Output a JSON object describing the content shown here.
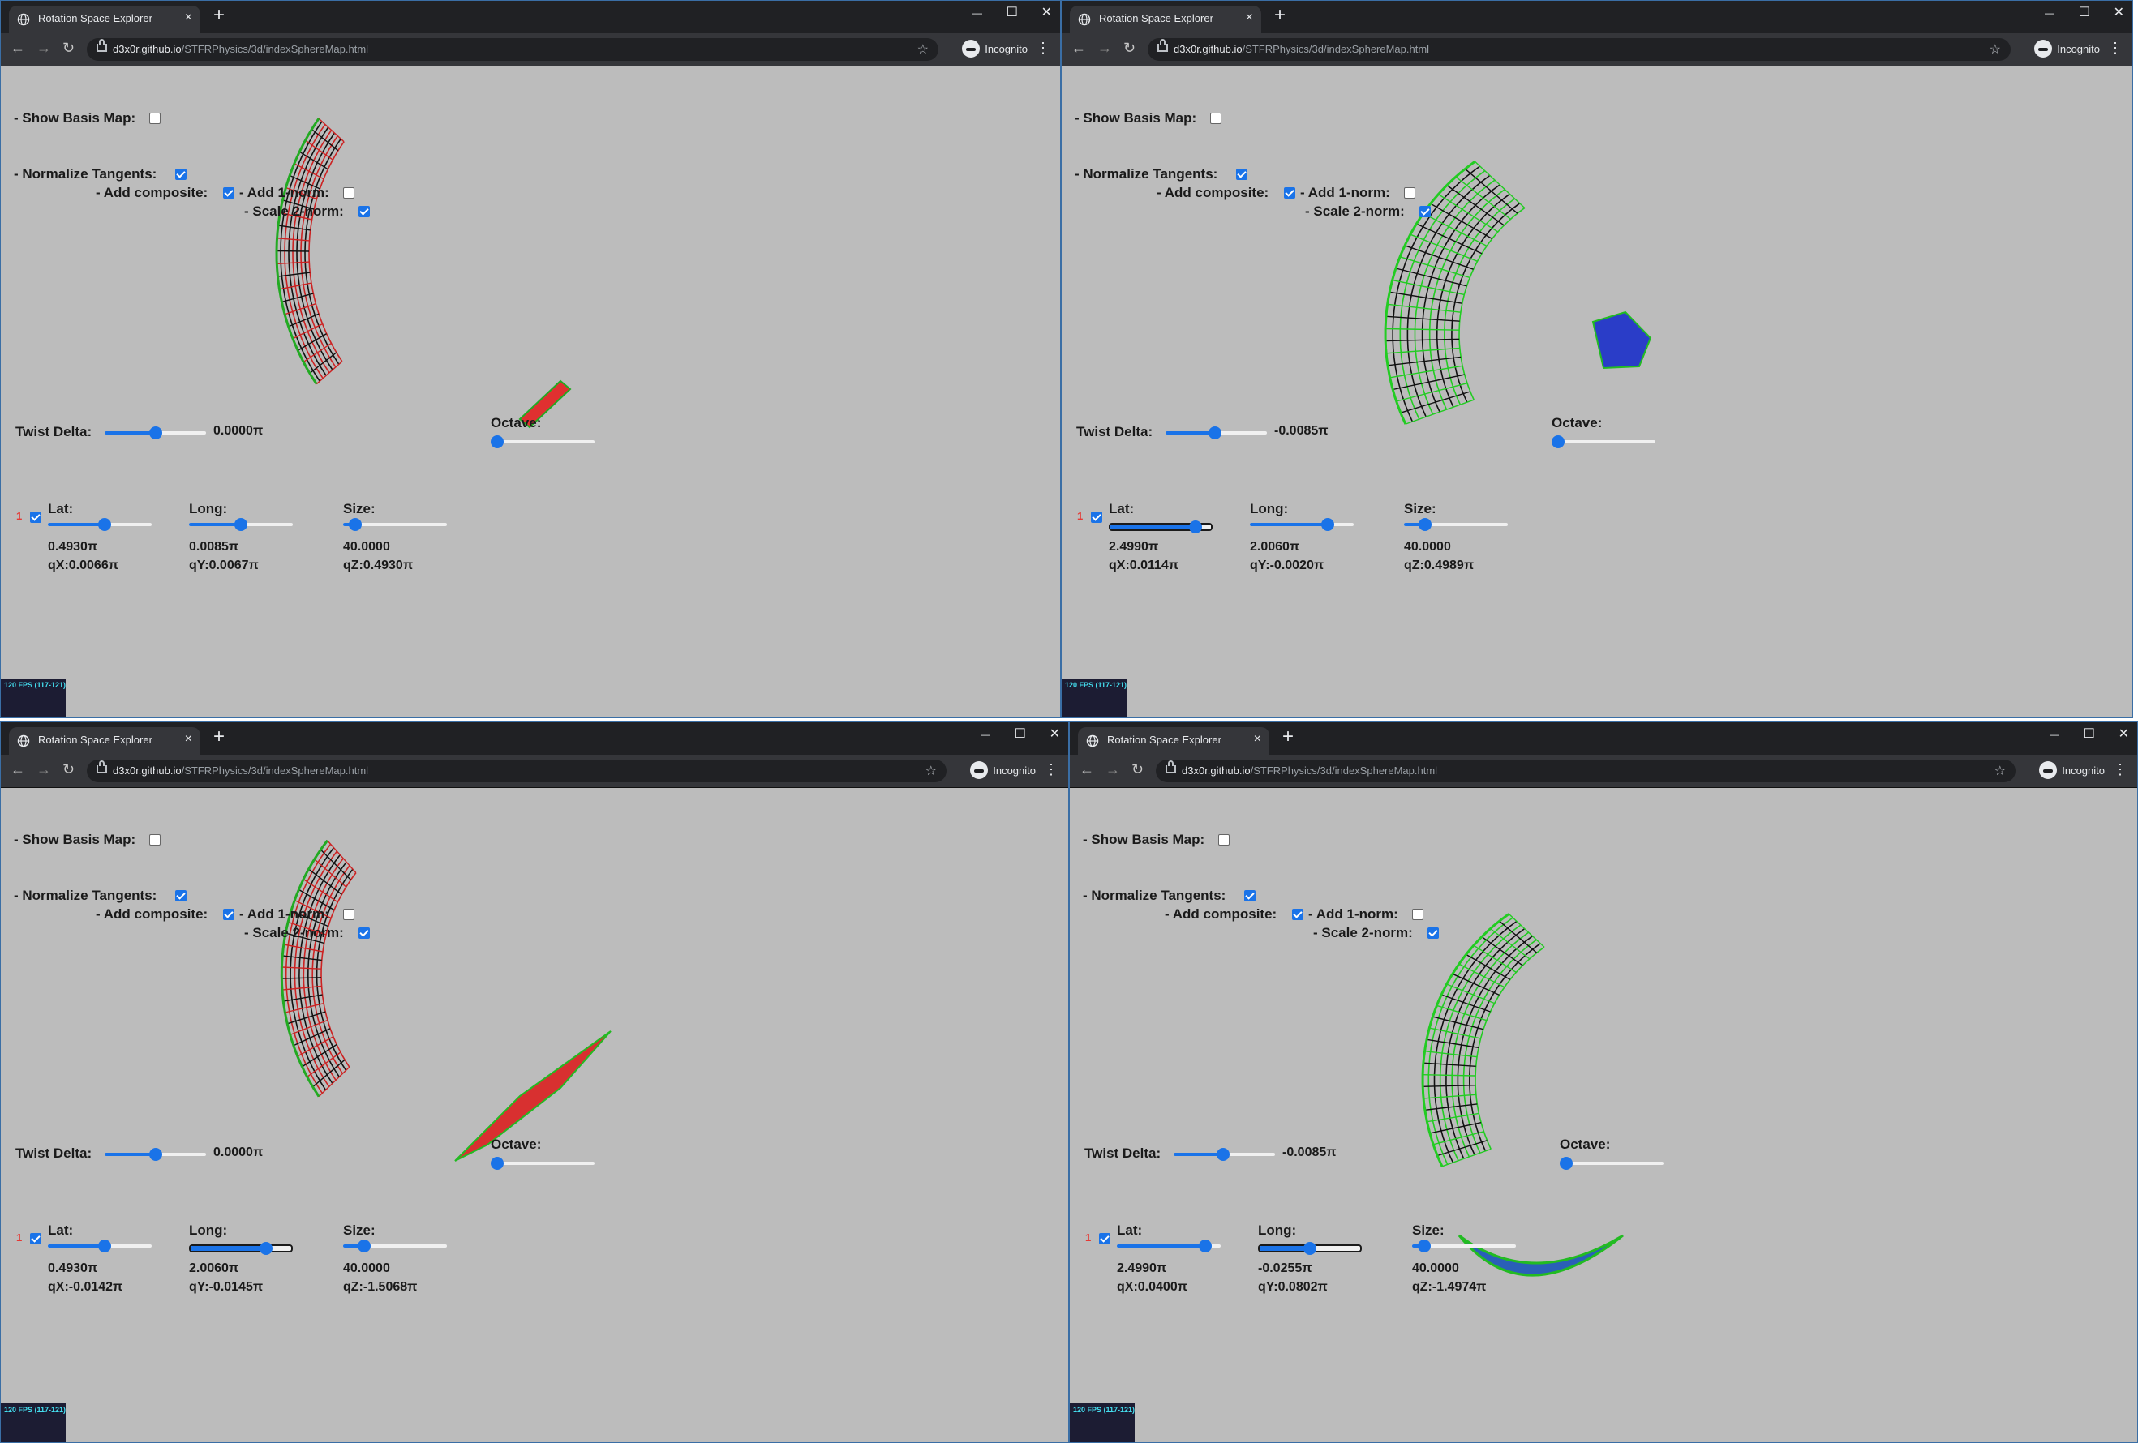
{
  "browser": {
    "tab_title": "Rotation Space Explorer",
    "url_host": "d3x0r.github.io",
    "url_path": "/STFRPhysics/3d/indexSphereMap.html",
    "incognito_label": "Incognito"
  },
  "labels": {
    "show_basis_map": "- Show Basis Map:",
    "normalize_tangents": "- Normalize Tangents:",
    "add_composite": "- Add composite:",
    "add_1norm": "- Add 1-norm:",
    "scale_2norm": "- Scale 2-norm:",
    "twist_delta": "Twist Delta:",
    "octave": "Octave:",
    "lat": "Lat:",
    "long": "Long:",
    "size": "Size:",
    "row_index": "1",
    "fps": "120 FPS (117-121)"
  },
  "panels": [
    {
      "checks": {
        "show_basis_map": false,
        "normalize_tangents": true,
        "add_composite": true,
        "add_1norm": false,
        "scale_2norm": true,
        "row_enabled": true
      },
      "twist_delta": {
        "value": "0.0000π",
        "level": 0.5
      },
      "octave": {
        "level": 0.0
      },
      "lat": {
        "value": "0.4930π",
        "level": 0.55,
        "focused": false
      },
      "long": {
        "value": "0.0085π",
        "level": 0.5,
        "focused": false
      },
      "size": {
        "value": "40.0000",
        "level": 0.12
      },
      "qx": "qX:0.0066π",
      "qy": "qY:0.0067π",
      "qz": "qZ:0.4930π",
      "mesh_colors": [
        "#cc2222",
        "#111111",
        "#22aa22"
      ]
    },
    {
      "checks": {
        "show_basis_map": false,
        "normalize_tangents": true,
        "add_composite": true,
        "add_1norm": false,
        "scale_2norm": true,
        "row_enabled": true
      },
      "twist_delta": {
        "value": "-0.0085π",
        "level": 0.49
      },
      "octave": {
        "level": 0.0
      },
      "lat": {
        "value": "2.4990π",
        "level": 0.85,
        "focused": true
      },
      "long": {
        "value": "2.0060π",
        "level": 0.75,
        "focused": false
      },
      "size": {
        "value": "40.0000",
        "level": 0.2
      },
      "qx": "qX:0.0114π",
      "qy": "qY:-0.0020π",
      "qz": "qZ:0.4989π",
      "mesh_colors": [
        "#22cc22",
        "#111111",
        "#2233cc"
      ]
    },
    {
      "checks": {
        "show_basis_map": false,
        "normalize_tangents": true,
        "add_composite": true,
        "add_1norm": false,
        "scale_2norm": true,
        "row_enabled": true
      },
      "twist_delta": {
        "value": "0.0000π",
        "level": 0.5
      },
      "octave": {
        "level": 0.0
      },
      "lat": {
        "value": "0.4930π",
        "level": 0.55,
        "focused": false
      },
      "long": {
        "value": "2.0060π",
        "level": 0.75,
        "focused": true
      },
      "size": {
        "value": "40.0000",
        "level": 0.2
      },
      "qx": "qX:-0.0142π",
      "qy": "qY:-0.0145π",
      "qz": "qZ:-1.5068π",
      "mesh_colors": [
        "#cc2222",
        "#111111",
        "#22aa22"
      ]
    },
    {
      "checks": {
        "show_basis_map": false,
        "normalize_tangents": true,
        "add_composite": true,
        "add_1norm": false,
        "scale_2norm": true,
        "row_enabled": true
      },
      "twist_delta": {
        "value": "-0.0085π",
        "level": 0.49
      },
      "octave": {
        "level": 0.0
      },
      "lat": {
        "value": "2.4990π",
        "level": 0.85,
        "focused": false
      },
      "long": {
        "value": "-0.0255π",
        "level": 0.5,
        "focused": true
      },
      "size": {
        "value": "40.0000",
        "level": 0.12
      },
      "qx": "qX:0.0400π",
      "qy": "qY:0.0802π",
      "qz": "qZ:-1.4974π",
      "mesh_colors": [
        "#22cc22",
        "#111111",
        "#2233cc"
      ]
    }
  ]
}
